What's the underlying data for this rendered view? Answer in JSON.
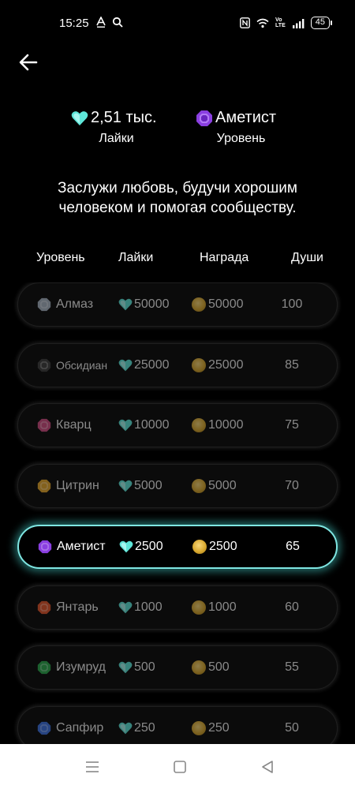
{
  "status": {
    "time": "15:25",
    "battery": "45",
    "network_label_top": "Vo",
    "network_label_bottom": "LTE"
  },
  "summary": {
    "likes_value": "2,51 тыс.",
    "likes_label": "Лайки",
    "level_value": "Аметист",
    "level_label": "Уровень"
  },
  "tagline": "Заслужи любовь, будучи хорошим человеком и помогая сообществу.",
  "table": {
    "headers": {
      "level": "Уровень",
      "likes": "Лайки",
      "reward": "Награда",
      "souls": "Души"
    },
    "rows": [
      {
        "level": "Алмаз",
        "likes": "50000",
        "reward": "50000",
        "souls": "100",
        "gem_color": "#9aa6b3",
        "active": false
      },
      {
        "level": "Обсидиан",
        "likes": "25000",
        "reward": "25000",
        "souls": "85",
        "gem_color": "#3a3a3a",
        "active": false
      },
      {
        "level": "Кварц",
        "likes": "10000",
        "reward": "10000",
        "souls": "75",
        "gem_color": "#c04878",
        "active": false
      },
      {
        "level": "Цитрин",
        "likes": "5000",
        "reward": "5000",
        "souls": "70",
        "gem_color": "#d49a2a",
        "active": false
      },
      {
        "level": "Аметист",
        "likes": "2500",
        "reward": "2500",
        "souls": "65",
        "gem_color": "#8a3fe0",
        "active": true
      },
      {
        "level": "Янтарь",
        "likes": "1000",
        "reward": "1000",
        "souls": "60",
        "gem_color": "#d0502a",
        "active": false
      },
      {
        "level": "Изумруд",
        "likes": "500",
        "reward": "500",
        "souls": "55",
        "gem_color": "#2a9a48",
        "active": false
      },
      {
        "level": "Сапфир",
        "likes": "250",
        "reward": "250",
        "souls": "50",
        "gem_color": "#3a6ad0",
        "active": false
      }
    ]
  },
  "colors": {
    "accent": "#7fe6e2",
    "heart": "#5ee6d9",
    "amethyst": "#8a3fe0"
  }
}
